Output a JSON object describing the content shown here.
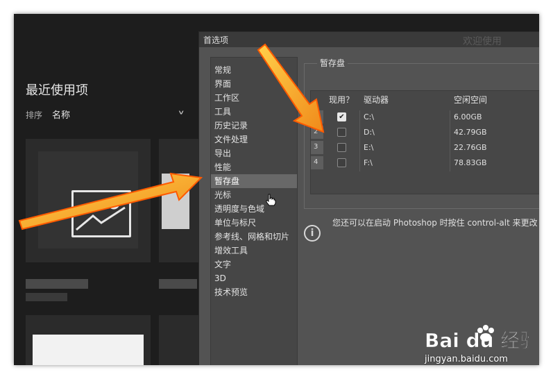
{
  "home": {
    "recent_title": "最近使用项",
    "sort_label": "排序",
    "sort_value": "名称",
    "sort_chevron": "∨"
  },
  "dialog": {
    "title": "首选项",
    "title_right": "欢迎使用",
    "nav_items": [
      "常规",
      "界面",
      "工作区",
      "工具",
      "历史记录",
      "文件处理",
      "导出",
      "性能",
      "暂存盘",
      "光标",
      "透明度与色域",
      "单位与标尺",
      "参考线、网格和切片",
      "增效工具",
      "文字",
      "3D",
      "技术预览"
    ],
    "active_item": "暂存盘",
    "scratch": {
      "legend": "暂存盘",
      "col_active": "现用？",
      "col_drive": "驱动器",
      "col_space": "空闲空间",
      "rows": [
        {
          "num": "1",
          "checked": true,
          "drive": "C:\\",
          "space": "6.00GB"
        },
        {
          "num": "2",
          "checked": false,
          "drive": "D:\\",
          "space": "42.79GB"
        },
        {
          "num": "3",
          "checked": false,
          "drive": "E:\\",
          "space": "22.76GB"
        },
        {
          "num": "4",
          "checked": false,
          "drive": "F:\\",
          "space": "78.83GB"
        }
      ]
    },
    "info_icon": "i",
    "info_text": "您还可以在启动 Photoshop 时按住 control-alt 来更改"
  },
  "watermark": {
    "logo": "Bai du 经验",
    "url": "jingyan.baidu.com"
  },
  "colors": {
    "arrow_fill": "#f5a623",
    "arrow_stroke": "#ff6a00"
  }
}
